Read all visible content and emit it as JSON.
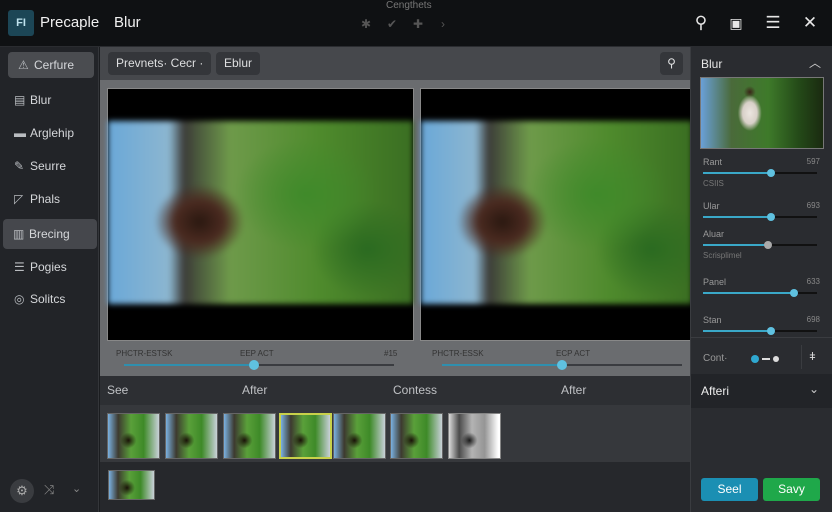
{
  "app": {
    "logo": "FI",
    "name": "Precaple",
    "doc_title": "Blur",
    "center_title": "Cengthets"
  },
  "topbar_icons": [
    "star-icon",
    "check-icon",
    "plus-icon",
    "chevron-right-icon"
  ],
  "top_right_icons": {
    "search": "⚲",
    "export": "▣",
    "menu": "☰",
    "close": "✕"
  },
  "sidebar": {
    "items": [
      {
        "label": "Cerfure",
        "icon": "⚠"
      },
      {
        "label": "Blur",
        "icon": "▤"
      },
      {
        "label": "Arglehip",
        "icon": "▬"
      },
      {
        "label": "Seurre",
        "icon": "✎"
      },
      {
        "label": "Phals",
        "icon": "◸"
      },
      {
        "label": "Brecing",
        "icon": "▥"
      },
      {
        "label": "Pogies",
        "icon": "☰"
      },
      {
        "label": "Solitcs",
        "icon": "◎"
      }
    ],
    "active": 5
  },
  "toolbar": {
    "presets": "Prevnets·  Cecr ·",
    "blur": "Eblur"
  },
  "sliders": {
    "left": {
      "label1": "PHCTR-ESTSK",
      "label2": "EEP ACT",
      "label3": "#15",
      "value": 0.48
    },
    "right": {
      "label1": "PHCTR-ESSK",
      "label2": "ECP ACT",
      "value": 0.5
    }
  },
  "labels": [
    "See",
    "After",
    "Contess",
    "After"
  ],
  "right_panel": {
    "title": "Blur",
    "controls": [
      {
        "label": "Rant",
        "value_text": "597",
        "sublabel": "CSIIS",
        "value": 0.6
      },
      {
        "label": "Ular",
        "value_text": "693",
        "value": 0.6
      },
      {
        "label": "Aluar",
        "value_text": "",
        "sublabel": "Scrisplimel",
        "value": 0.57
      },
      {
        "label": "Panel",
        "value_text": "633",
        "value": 0.8
      },
      {
        "label": "Stan",
        "value_text": "698",
        "value": 0.6
      }
    ],
    "toggle_label": "Cont·",
    "after_label": "Afteri",
    "btn_cancel": "Seel",
    "btn_save": "Savy",
    "cancel_color": "#1b8fb3",
    "save_color": "#1fa84a"
  }
}
